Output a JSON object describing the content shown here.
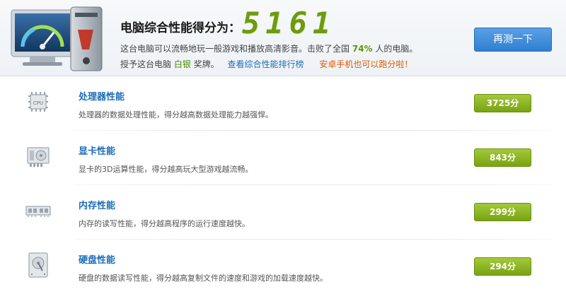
{
  "header": {
    "score_title": "电脑综合性能得分为：",
    "score_value": "5161",
    "desc_prefix": "这台电脑可以流畅地玩一般游戏和播放高清影音。击败了全国",
    "desc_percent": "74%",
    "desc_suffix": "人的电脑。",
    "award_prefix": "授予这台电脑",
    "award_medal": "白银",
    "award_suffix": "奖牌。",
    "rank_link": "查看综合性能排行榜",
    "mobile_link": "安卓手机也可以跑分啦！",
    "retest_button": "再测一下"
  },
  "items": [
    {
      "title": "处理器性能",
      "desc": "处理器的数据处理性能，得分越高数据处理能力越强悍。",
      "score": "3725分",
      "icon": "cpu-icon"
    },
    {
      "title": "显卡性能",
      "desc": "显卡的3D运算性能，得分越高玩大型游戏越流畅。",
      "score": "843分",
      "icon": "graphics-card-icon"
    },
    {
      "title": "内存性能",
      "desc": "内存的读写性能，得分越高程序的运行速度越快。",
      "score": "299分",
      "icon": "memory-icon"
    },
    {
      "title": "硬盘性能",
      "desc": "硬盘的数据读写性能，得分越高复制文件的速度和游戏的加载速度越快。",
      "score": "294分",
      "icon": "hard-disk-icon"
    }
  ],
  "colors": {
    "link_blue": "#1d6cb8",
    "score_green": "#78a314",
    "accent_orange": "#e05a00",
    "button_blue": "#2f7fd0"
  }
}
